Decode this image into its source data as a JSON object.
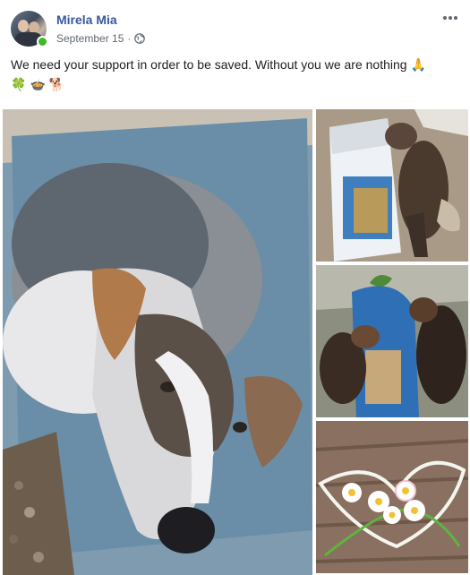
{
  "post": {
    "author_name": "Mirela Mia",
    "date": "September 15",
    "separator": "·",
    "privacy_icon": "globe-icon",
    "more_icon": "more-options-icon",
    "text": "We need your support in order to be saved. Without you we are nothing",
    "emojis": [
      "🙏",
      "🍀",
      "🍲",
      "🐕"
    ]
  },
  "media": {
    "photos": [
      {
        "name": "photo-dog-lying-in-wheelbarrow"
      },
      {
        "name": "photo-puppy-with-food-bag"
      },
      {
        "name": "photo-puppies-eating-from-bag"
      },
      {
        "name": "photo-daisies-with-ribbon-heart"
      }
    ]
  },
  "colors": {
    "author_link": "#385898",
    "meta_text": "#606770",
    "online": "#42b72a"
  }
}
